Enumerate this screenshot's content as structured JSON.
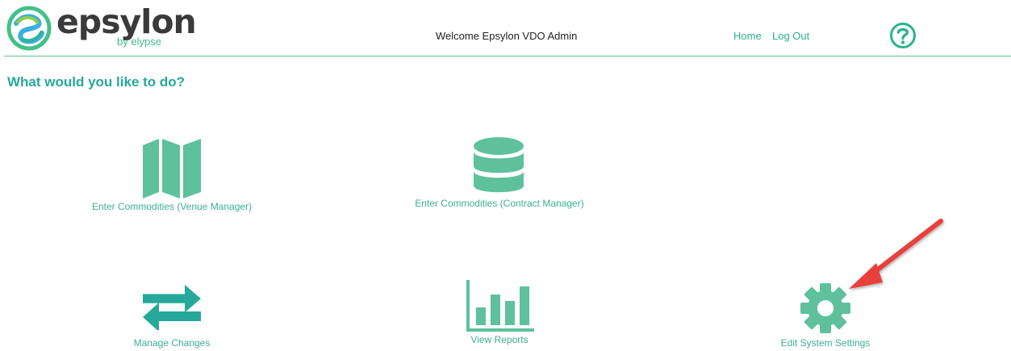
{
  "header": {
    "logo_text": "epsylon",
    "logo_subtext": "by elypse",
    "welcome_text": "Welcome Epsylon VDO Admin",
    "nav": {
      "home": "Home",
      "logout": "Log Out"
    },
    "help_icon": "question-circle-icon"
  },
  "main": {
    "title": "What would you like to do?",
    "tiles": [
      {
        "label": "Enter Commodities (Venue Manager)",
        "icon": "map-icon"
      },
      {
        "label": "Enter Commodities (Contract Manager)",
        "icon": "database-icon"
      },
      {
        "label": "Manage Changes",
        "icon": "exchange-arrows-icon"
      },
      {
        "label": "View Reports",
        "icon": "bar-chart-icon"
      },
      {
        "label": "Edit System Settings",
        "icon": "gear-icon"
      }
    ]
  },
  "colors": {
    "accent": "#5ec19c",
    "title": "#26a99a",
    "link": "#2bae92",
    "annotation_arrow": "#e8413c"
  }
}
